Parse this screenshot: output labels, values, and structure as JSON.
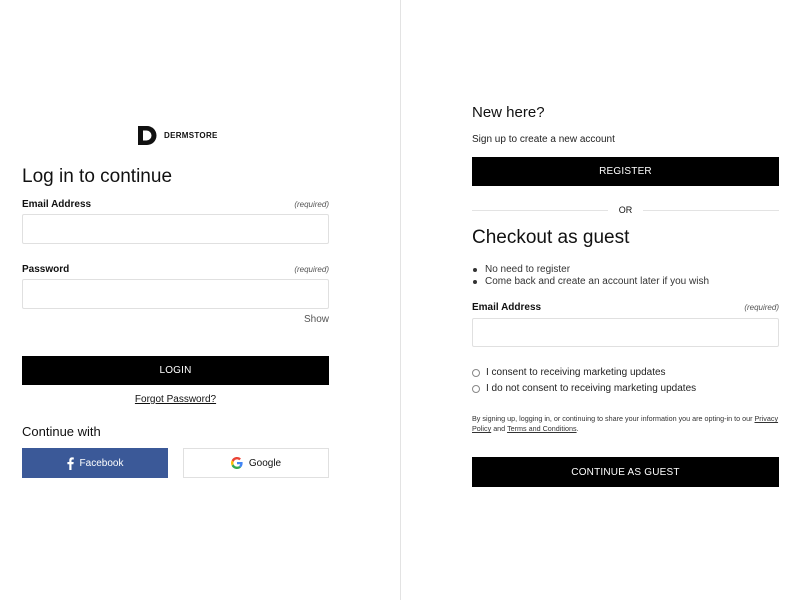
{
  "brand": {
    "name": "DERMSTORE"
  },
  "login": {
    "title": "Log in to continue",
    "email_label": "Email Address",
    "email_required": "(required)",
    "email_value": "",
    "password_label": "Password",
    "password_required": "(required)",
    "password_value": "",
    "show_label": "Show",
    "login_button": "LOGIN",
    "forgot_link": "Forgot Password?",
    "continue_with": "Continue with",
    "facebook_button": "Facebook",
    "google_button": "Google"
  },
  "register": {
    "title": "New here?",
    "subtitle": "Sign up to create a new account",
    "button": "REGISTER",
    "or": "OR"
  },
  "guest": {
    "title": "Checkout as guest",
    "bullets": [
      "No need to register",
      "Come back and create an account later if you wish"
    ],
    "email_label": "Email Address",
    "email_required": "(required)",
    "email_value": "",
    "consent_yes": "I consent to receiving marketing updates",
    "consent_no": "I do not consent to receiving marketing updates",
    "legal_prefix": "By signing up, logging in, or continuing to share your information you are opting-in to our",
    "privacy_link": "Privacy Policy",
    "legal_and": "and",
    "terms_link": "Terms and Conditions",
    "legal_suffix": ".",
    "button": "CONTINUE AS GUEST"
  },
  "colors": {
    "black": "#000000",
    "facebook": "#3b5998",
    "divider": "#e3e3e3"
  }
}
